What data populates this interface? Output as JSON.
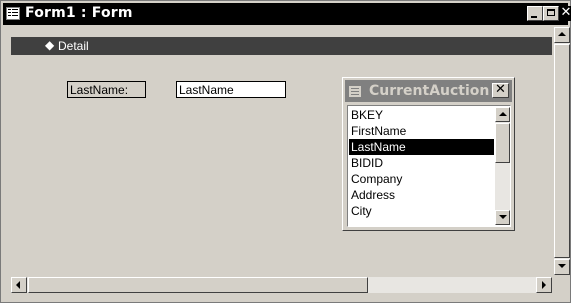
{
  "window": {
    "title": "Form1 : Form",
    "icon": "form-icon",
    "close_glyph": "✕"
  },
  "section": {
    "label": "Detail",
    "icon": "section-arrow-icon",
    "icon_glyph": "◆"
  },
  "controls": {
    "label_text": "LastName:",
    "textbox_text": "LastName"
  },
  "field_list": {
    "title": "CurrentAuction",
    "close_glyph": "✕",
    "items": [
      {
        "label": "BKEY"
      },
      {
        "label": "FirstName"
      },
      {
        "label": "LastName"
      },
      {
        "label": "BIDID"
      },
      {
        "label": "Company"
      },
      {
        "label": "Address"
      },
      {
        "label": "City"
      }
    ],
    "selected": "LastName"
  },
  "colors": {
    "titlebar": "#000000",
    "face": "#d4d0c8",
    "selection": "#000000",
    "section_bar": "#404040"
  }
}
